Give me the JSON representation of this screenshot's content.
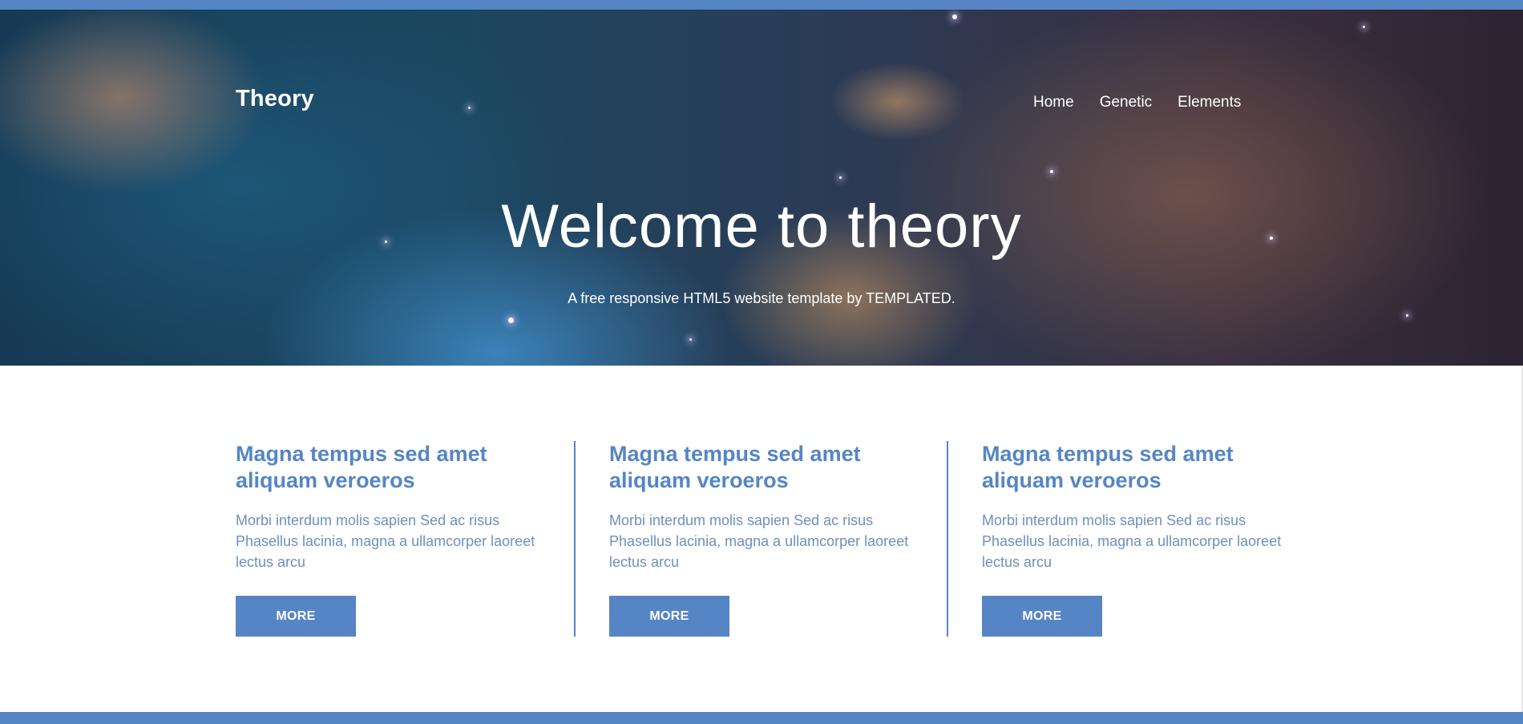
{
  "site": {
    "logo": "Theory",
    "nav": [
      "Home",
      "Genetic",
      "Elements"
    ]
  },
  "hero": {
    "title": "Welcome to theory",
    "subtitle": "A free responsive HTML5 website template by TEMPLATED."
  },
  "features": [
    {
      "title": "Magna tempus sed amet aliquam veroeros",
      "text": "Morbi interdum molis sapien Sed ac risus Phasellus lacinia, magna a ullamcorper laoreet lectus arcu",
      "button": "MORE"
    },
    {
      "title": "Magna tempus sed amet aliquam veroeros",
      "text": "Morbi interdum molis sapien Sed ac risus Phasellus lacinia, magna a ullamcorper laoreet lectus arcu",
      "button": "MORE"
    },
    {
      "title": "Magna tempus sed amet aliquam veroeros",
      "text": "Morbi interdum molis sapien Sed ac risus Phasellus lacinia, magna a ullamcorper laoreet lectus arcu",
      "button": "MORE"
    }
  ],
  "colors": {
    "accent": "#5585c5",
    "body_text": "#6f8fbf",
    "white": "#ffffff"
  }
}
